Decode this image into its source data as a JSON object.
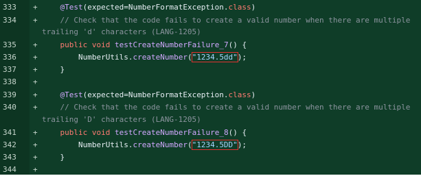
{
  "diff": {
    "lines": [
      {
        "num": "333",
        "sign": "+",
        "code": {
          "indent": "    ",
          "annotation": "@Test",
          "paren": "(expected=NumberFormatException.",
          "keyword": "class",
          "close": ")"
        }
      },
      {
        "num": "334",
        "sign": "+",
        "comment": "    // Check that the code fails to create a valid number when there are multiple"
      },
      {
        "num": "",
        "sign": "",
        "comment": "trailing 'd' characters (LANG-1205)"
      },
      {
        "num": "335",
        "sign": "+",
        "method": {
          "indent": "    ",
          "kw1": "public",
          "kw2": "void",
          "name": "testCreateNumberFailure_7",
          "rest": "() {"
        }
      },
      {
        "num": "336",
        "sign": "+",
        "call": {
          "indent": "        ",
          "prefix": "NumberUtils.",
          "fn": "createNumber",
          "open": "(",
          "str": "\"1234.5dd\"",
          "close": ");"
        }
      },
      {
        "num": "337",
        "sign": "+",
        "plain": "    }"
      },
      {
        "num": "338",
        "sign": "+",
        "plain": ""
      },
      {
        "num": "339",
        "sign": "+",
        "code": {
          "indent": "    ",
          "annotation": "@Test",
          "paren": "(expected=NumberFormatException.",
          "keyword": "class",
          "close": ")"
        }
      },
      {
        "num": "340",
        "sign": "+",
        "comment": "    // Check that the code fails to create a valid number when there are multiple"
      },
      {
        "num": "",
        "sign": "",
        "comment": "trailing 'D' characters (LANG-1205)"
      },
      {
        "num": "341",
        "sign": "+",
        "method": {
          "indent": "    ",
          "kw1": "public",
          "kw2": "void",
          "name": "testCreateNumberFailure_8",
          "rest": "() {"
        }
      },
      {
        "num": "342",
        "sign": "+",
        "call": {
          "indent": "        ",
          "prefix": "NumberUtils.",
          "fn": "createNumber",
          "open": "(",
          "str": "\"1234.5DD\"",
          "close": ");"
        }
      },
      {
        "num": "343",
        "sign": "+",
        "plain": "    }"
      },
      {
        "num": "344",
        "sign": "+",
        "plain": ""
      }
    ]
  },
  "colors": {
    "gutter_bg": "#0d3522",
    "code_bg": "#0f3d28",
    "highlight_box": "#e5312f"
  }
}
